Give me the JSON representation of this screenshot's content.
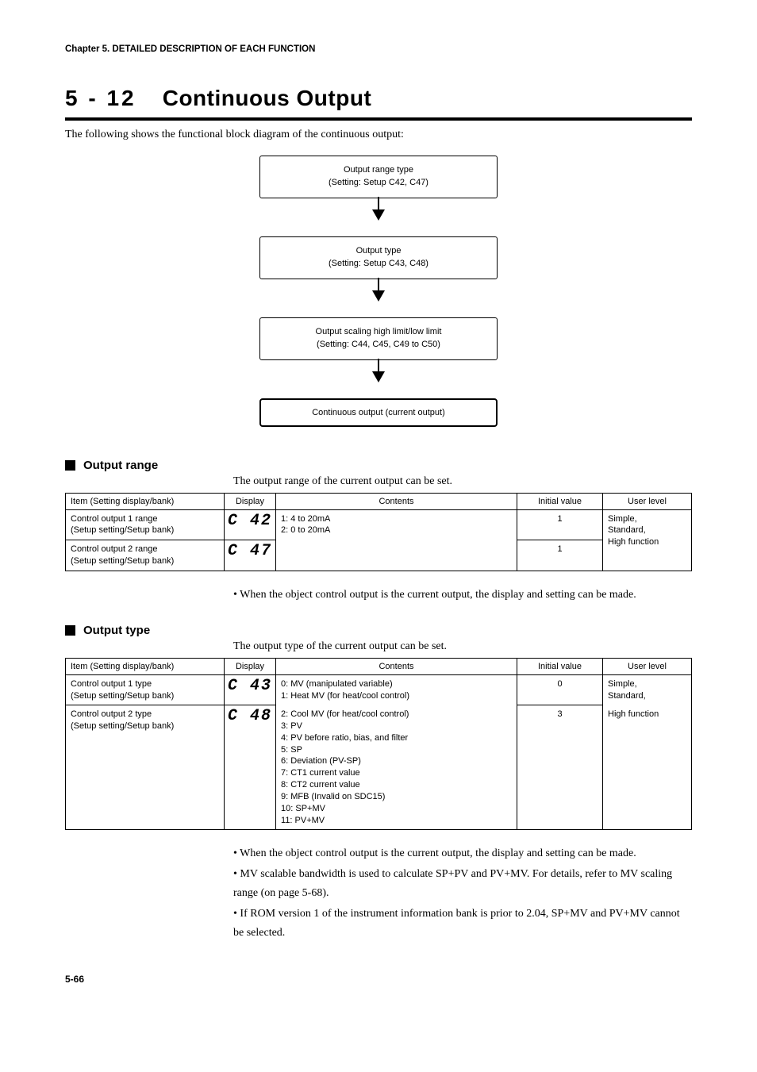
{
  "chapter": "Chapter 5. DETAILED DESCRIPTION OF EACH FUNCTION",
  "title_number": "5  -  12",
  "title_text": "Continuous Output",
  "intro": "The following shows the functional block diagram of the continuous output:",
  "diagram": {
    "box1_line1": "Output range type",
    "box1_line2": "(Setting: Setup C42, C47)",
    "box2_line1": "Output type",
    "box2_line2": "(Setting: Setup C43, C48)",
    "box3_line1": "Output scaling high limit/low limit",
    "box3_line2": "(Setting: C44, C45, C49 to C50)",
    "box4": "Continuous output (current output)"
  },
  "section1": {
    "title": "Output range",
    "intro": "The output range of the current output can be set.",
    "headers": {
      "item": "Item (Setting display/bank)",
      "display": "Display",
      "contents": "Contents",
      "initial": "Initial value",
      "user": "User level"
    },
    "row1": {
      "item_line1": "Control output 1 range",
      "item_line2": "(Setup setting/Setup bank)",
      "display": "C  42",
      "contents_line1": "1: 4 to 20mA",
      "contents_line2": "2: 0 to 20mA",
      "initial": "1",
      "user_line1": "Simple,",
      "user_line2": "Standard,",
      "user_line3": "High function"
    },
    "row2": {
      "item_line1": "Control output 2 range",
      "item_line2": "(Setup setting/Setup bank)",
      "display": "C  47",
      "initial": "1"
    },
    "note": "• When the object control output is the current output, the display and setting can be made."
  },
  "section2": {
    "title": "Output type",
    "intro": "The output type of the current output can be set.",
    "headers": {
      "item": "Item (Setting display/bank)",
      "display": "Display",
      "contents": "Contents",
      "initial": "Initial value",
      "user": "User level"
    },
    "row1": {
      "item_line1": "Control output 1 type",
      "item_line2": "(Setup setting/Setup bank)",
      "display": "C  43",
      "contents_l0": "0: MV (manipulated variable)",
      "contents_l1": "1: Heat MV (for heat/cool control)",
      "contents_l2": "2: Cool MV (for heat/cool control)",
      "contents_l3": "3: PV",
      "contents_l4": "4: PV before ratio, bias, and filter",
      "contents_l5": "5: SP",
      "contents_l6": "6: Deviation (PV-SP)",
      "contents_l7": "7: CT1 current value",
      "contents_l8": "8: CT2 current value",
      "contents_l9": "9: MFB (Invalid on SDC15)",
      "contents_l10": "10: SP+MV",
      "contents_l11": "11: PV+MV",
      "initial": "0",
      "user_line1": "Simple,",
      "user_line2": "Standard,",
      "user_line3": "High function"
    },
    "row2": {
      "item_line1": "Control output 2 type",
      "item_line2": "(Setup setting/Setup bank)",
      "display": "C  48",
      "initial": "3"
    },
    "note1": "• When the object control output is the current output, the display and setting can be made.",
    "note2": "• MV scalable bandwidth is used to calculate SP+PV and PV+MV. For details, refer to MV scaling range (on page 5-68).",
    "note3": "• If ROM version 1 of the instrument information bank is prior to 2.04, SP+MV and PV+MV cannot be selected."
  },
  "page_number": "5-66"
}
